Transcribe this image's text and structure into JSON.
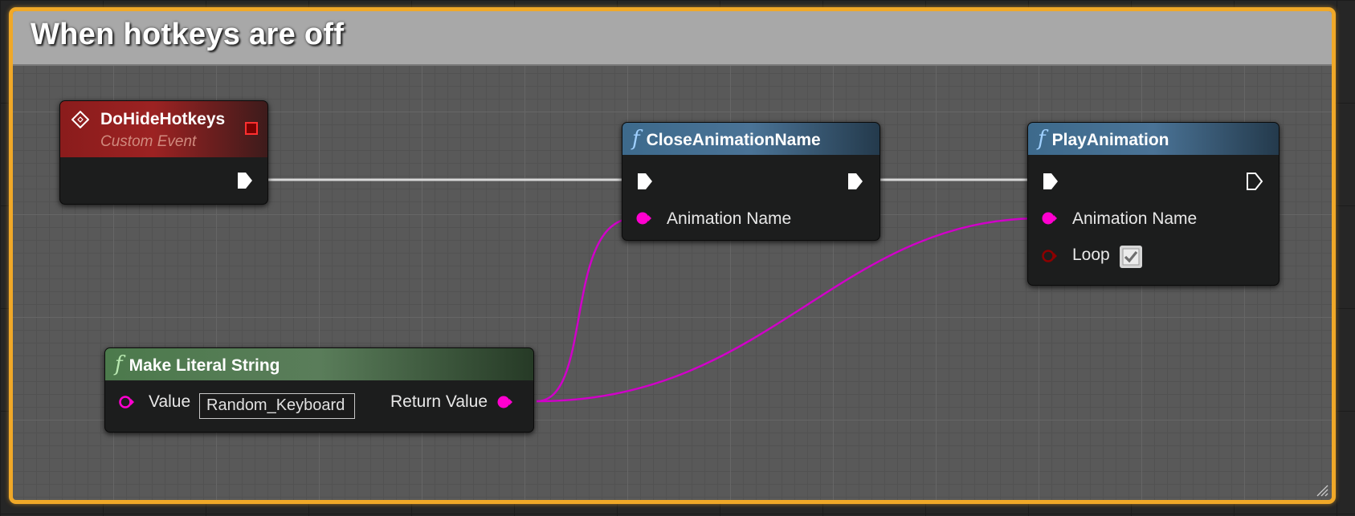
{
  "comment": {
    "title": "When hotkeys are off"
  },
  "nodes": {
    "event": {
      "title": "DoHideHotkeys",
      "subtitle": "Custom Event"
    },
    "close_anim": {
      "title": "CloseAnimationName",
      "pin_animation_name": "Animation Name"
    },
    "play_anim": {
      "title": "PlayAnimation",
      "pin_animation_name": "Animation Name",
      "pin_loop": "Loop",
      "loop_checked": true
    },
    "make_literal": {
      "title": "Make Literal String",
      "pin_value": "Value",
      "value": "Random_Keyboard",
      "pin_return": "Return Value"
    }
  },
  "icons": {
    "event": "event-diamond-icon",
    "function": "function-f-icon",
    "exec": "exec-pin-icon",
    "string": "string-pin-icon"
  },
  "colors": {
    "comment_border": "#f0a828",
    "event_header": "#8a1c1c",
    "function_header": "#3d6a8c",
    "pure_header": "#4c7a4c",
    "string_pin": "#ff00d0",
    "bool_pin": "#8c0000",
    "exec_wire": "#d0d0d0"
  }
}
